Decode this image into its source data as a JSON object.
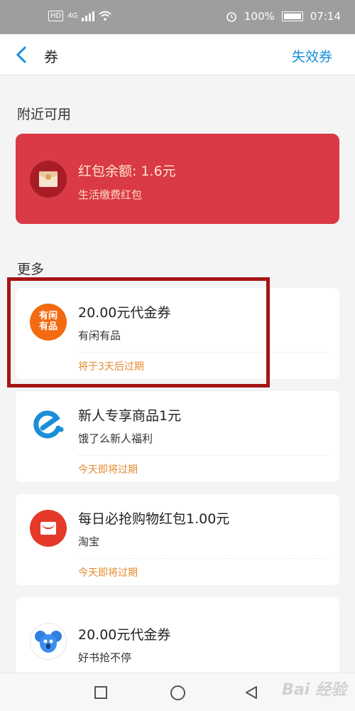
{
  "status_bar": {
    "hd": "HD",
    "network": "4G",
    "battery": "100%",
    "time": "07:14"
  },
  "nav": {
    "title": "券",
    "right_link": "失效券"
  },
  "nearby": {
    "section_title": "附近可用",
    "red_packet": {
      "title": "红包余额: 1.6元",
      "subtitle": "生活缴费红包"
    }
  },
  "more": {
    "section_title": "更多",
    "coupons": [
      {
        "name": "20.00元代金券",
        "merchant": "有闲有品",
        "expire": "将于3天后过期",
        "logo": "xianyu-logo",
        "logo_text": "有闲有品"
      },
      {
        "name": "新人专享商品1元",
        "merchant": "饿了么新人福利",
        "expire": "今天即将过期",
        "logo": "eleme-logo"
      },
      {
        "name": "每日必抢购物红包1.00元",
        "merchant": "淘宝",
        "expire": "今天即将过期",
        "logo": "taobao-redpacket-logo"
      },
      {
        "name": "20.00元代金券",
        "merchant": "好书抢不停",
        "expire": "",
        "logo": "koala-logo"
      }
    ]
  },
  "colors": {
    "accent": "#1a8fd8",
    "red_packet": "#d93a45",
    "expire_text": "#e68a2e",
    "highlight": "#a61414"
  },
  "watermark": "Bai 经验"
}
